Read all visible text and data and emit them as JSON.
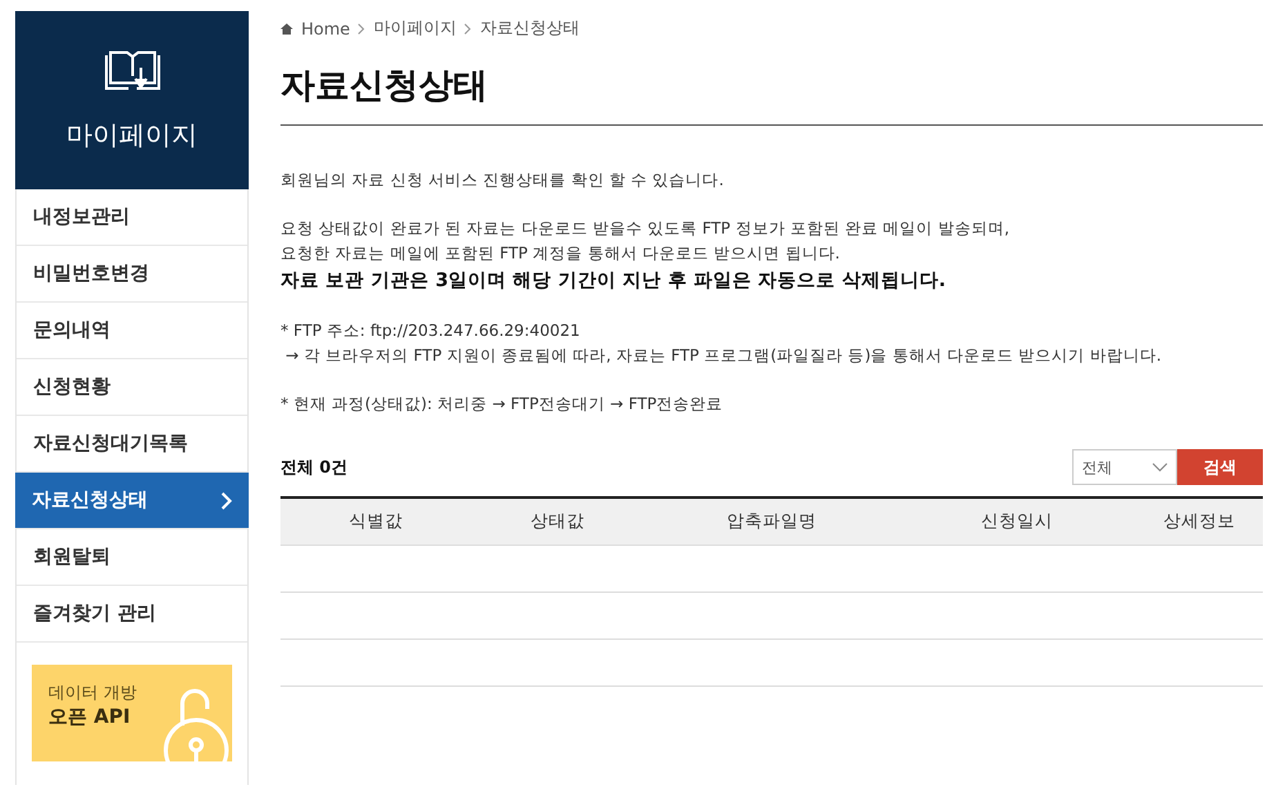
{
  "sidebar": {
    "title": "마이페이지",
    "items": [
      {
        "label": "내정보관리",
        "selected": false
      },
      {
        "label": "비밀번호변경",
        "selected": false
      },
      {
        "label": "문의내역",
        "selected": false
      },
      {
        "label": "신청현황",
        "selected": false
      },
      {
        "label": "자료신청대기목록",
        "selected": false
      },
      {
        "label": "자료신청상태",
        "selected": true
      },
      {
        "label": "회원탈퇴",
        "selected": false
      },
      {
        "label": "즐겨찾기 관리",
        "selected": false
      }
    ],
    "banner": {
      "line_1": "데이터 개방",
      "line_2": "오픈 API"
    }
  },
  "breadcrumb": [
    "Home",
    "마이페이지",
    "자료신청상태"
  ],
  "page_title": "자료신청상태",
  "paragraphs": [
    [
      {
        "text": "회원님의 자료 신청 서비스 진행상태를 확인 할 수 있습니다.",
        "kind": "normal"
      }
    ],
    [
      {
        "text": "요청 상태값이 완료가 된 자료는 다운로드 받을수 있도록 FTP 정보가 포함된 완료 메일이 발송되며,",
        "kind": "normal"
      },
      {
        "text": "요청한 자료는 메일에 포함된 FTP 계정을 통해서 다운로드 받으시면 됩니다.",
        "kind": "normal"
      },
      {
        "text": "자료 보관 기관은 3일이며 해당 기간이 지난 후 파일은 자동으로 삭제됩니다.",
        "kind": "bold"
      }
    ],
    [
      {
        "text": "* FTP 주소: ftp://203.247.66.29:40021",
        "kind": "normal"
      },
      {
        "text": " → 각 브라우저의 FTP 지원이 종료됨에 따라, 자료는 FTP 프로그램(파일질라 등)을 통해서 다운로드 받으시기 바랍니다.",
        "kind": "normal"
      }
    ],
    [
      {
        "text": "* 현재 과정(상태값): 처리중 → FTP전송대기 → FTP전송완료",
        "kind": "normal"
      }
    ]
  ],
  "total": "전체 0건",
  "filter": {
    "value": "전체"
  },
  "search_button": "검색",
  "table": {
    "columns": [
      "식별값",
      "상태값",
      "압축파일명",
      "신청일시",
      "상세정보"
    ]
  }
}
